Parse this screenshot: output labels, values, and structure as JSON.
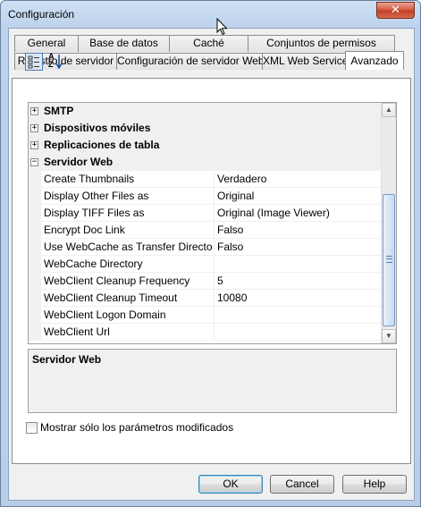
{
  "window": {
    "title": "Configuración",
    "close_glyph": "✕"
  },
  "tabs": {
    "row1": [
      "General",
      "Base de datos",
      "Caché",
      "Conjuntos de permisos"
    ],
    "row2": [
      "Registro de servidor",
      "Configuración de servidor Web",
      "XML Web Service",
      "Avanzado"
    ],
    "active": "Avanzado"
  },
  "toolbar": {
    "categorized_icon": "categorized-icon",
    "alphabetical_icon": "sort-az-icon",
    "alpha_glyph_a": "A",
    "alpha_glyph_z": "Z"
  },
  "grid": {
    "categories_collapsed": [
      {
        "label": "SMTP",
        "toggle": "+"
      },
      {
        "label": "Dispositivos móviles",
        "toggle": "+"
      },
      {
        "label": "Replicaciones de tabla",
        "toggle": "+"
      }
    ],
    "category_expanded": {
      "label": "Servidor Web",
      "toggle": "−"
    },
    "properties": [
      {
        "name": "Create Thumbnails",
        "value": "Verdadero"
      },
      {
        "name": "Display Other Files as",
        "value": "Original"
      },
      {
        "name": "Display TIFF Files as",
        "value": "Original (Image Viewer)"
      },
      {
        "name": "Encrypt Doc Link",
        "value": "Falso"
      },
      {
        "name": "Use WebCache as Transfer Directory",
        "value": "Falso"
      },
      {
        "name": "WebCache Directory",
        "value": ""
      },
      {
        "name": "WebClient Cleanup Frequency",
        "value": "5"
      },
      {
        "name": "WebClient Cleanup Timeout",
        "value": "10080"
      },
      {
        "name": "WebClient Logon Domain",
        "value": ""
      },
      {
        "name": "WebClient Url",
        "value": ""
      }
    ]
  },
  "description": {
    "title": "Servidor Web"
  },
  "checkbox": {
    "label": "Mostrar sólo los parámetros modificados",
    "checked": false
  },
  "buttons": {
    "ok": "OK",
    "cancel": "Cancel",
    "help": "Help"
  },
  "colors": {
    "title_bar": "#c4d8ee",
    "close_button": "#c94a31",
    "accent_border": "#3c7fb1"
  }
}
